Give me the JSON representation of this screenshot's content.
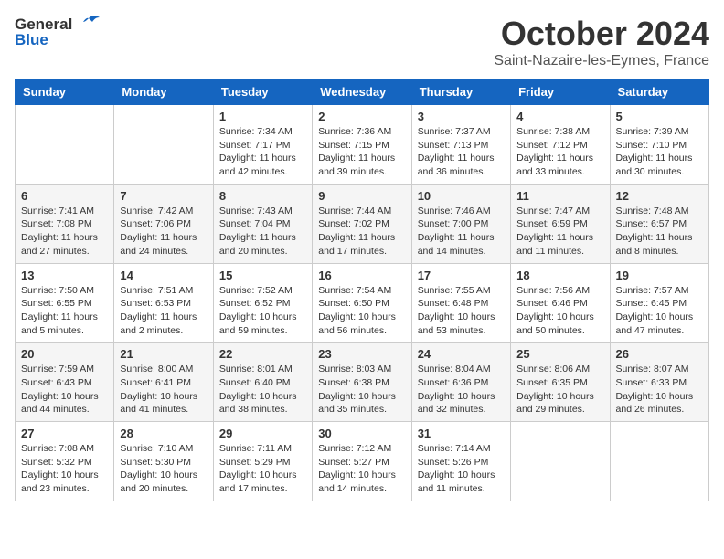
{
  "logo": {
    "general": "General",
    "blue": "Blue"
  },
  "title": {
    "month": "October 2024",
    "location": "Saint-Nazaire-les-Eymes, France"
  },
  "days_of_week": [
    "Sunday",
    "Monday",
    "Tuesday",
    "Wednesday",
    "Thursday",
    "Friday",
    "Saturday"
  ],
  "weeks": [
    [
      {
        "day": "",
        "info": ""
      },
      {
        "day": "",
        "info": ""
      },
      {
        "day": "1",
        "info": "Sunrise: 7:34 AM\nSunset: 7:17 PM\nDaylight: 11 hours and 42 minutes."
      },
      {
        "day": "2",
        "info": "Sunrise: 7:36 AM\nSunset: 7:15 PM\nDaylight: 11 hours and 39 minutes."
      },
      {
        "day": "3",
        "info": "Sunrise: 7:37 AM\nSunset: 7:13 PM\nDaylight: 11 hours and 36 minutes."
      },
      {
        "day": "4",
        "info": "Sunrise: 7:38 AM\nSunset: 7:12 PM\nDaylight: 11 hours and 33 minutes."
      },
      {
        "day": "5",
        "info": "Sunrise: 7:39 AM\nSunset: 7:10 PM\nDaylight: 11 hours and 30 minutes."
      }
    ],
    [
      {
        "day": "6",
        "info": "Sunrise: 7:41 AM\nSunset: 7:08 PM\nDaylight: 11 hours and 27 minutes."
      },
      {
        "day": "7",
        "info": "Sunrise: 7:42 AM\nSunset: 7:06 PM\nDaylight: 11 hours and 24 minutes."
      },
      {
        "day": "8",
        "info": "Sunrise: 7:43 AM\nSunset: 7:04 PM\nDaylight: 11 hours and 20 minutes."
      },
      {
        "day": "9",
        "info": "Sunrise: 7:44 AM\nSunset: 7:02 PM\nDaylight: 11 hours and 17 minutes."
      },
      {
        "day": "10",
        "info": "Sunrise: 7:46 AM\nSunset: 7:00 PM\nDaylight: 11 hours and 14 minutes."
      },
      {
        "day": "11",
        "info": "Sunrise: 7:47 AM\nSunset: 6:59 PM\nDaylight: 11 hours and 11 minutes."
      },
      {
        "day": "12",
        "info": "Sunrise: 7:48 AM\nSunset: 6:57 PM\nDaylight: 11 hours and 8 minutes."
      }
    ],
    [
      {
        "day": "13",
        "info": "Sunrise: 7:50 AM\nSunset: 6:55 PM\nDaylight: 11 hours and 5 minutes."
      },
      {
        "day": "14",
        "info": "Sunrise: 7:51 AM\nSunset: 6:53 PM\nDaylight: 11 hours and 2 minutes."
      },
      {
        "day": "15",
        "info": "Sunrise: 7:52 AM\nSunset: 6:52 PM\nDaylight: 10 hours and 59 minutes."
      },
      {
        "day": "16",
        "info": "Sunrise: 7:54 AM\nSunset: 6:50 PM\nDaylight: 10 hours and 56 minutes."
      },
      {
        "day": "17",
        "info": "Sunrise: 7:55 AM\nSunset: 6:48 PM\nDaylight: 10 hours and 53 minutes."
      },
      {
        "day": "18",
        "info": "Sunrise: 7:56 AM\nSunset: 6:46 PM\nDaylight: 10 hours and 50 minutes."
      },
      {
        "day": "19",
        "info": "Sunrise: 7:57 AM\nSunset: 6:45 PM\nDaylight: 10 hours and 47 minutes."
      }
    ],
    [
      {
        "day": "20",
        "info": "Sunrise: 7:59 AM\nSunset: 6:43 PM\nDaylight: 10 hours and 44 minutes."
      },
      {
        "day": "21",
        "info": "Sunrise: 8:00 AM\nSunset: 6:41 PM\nDaylight: 10 hours and 41 minutes."
      },
      {
        "day": "22",
        "info": "Sunrise: 8:01 AM\nSunset: 6:40 PM\nDaylight: 10 hours and 38 minutes."
      },
      {
        "day": "23",
        "info": "Sunrise: 8:03 AM\nSunset: 6:38 PM\nDaylight: 10 hours and 35 minutes."
      },
      {
        "day": "24",
        "info": "Sunrise: 8:04 AM\nSunset: 6:36 PM\nDaylight: 10 hours and 32 minutes."
      },
      {
        "day": "25",
        "info": "Sunrise: 8:06 AM\nSunset: 6:35 PM\nDaylight: 10 hours and 29 minutes."
      },
      {
        "day": "26",
        "info": "Sunrise: 8:07 AM\nSunset: 6:33 PM\nDaylight: 10 hours and 26 minutes."
      }
    ],
    [
      {
        "day": "27",
        "info": "Sunrise: 7:08 AM\nSunset: 5:32 PM\nDaylight: 10 hours and 23 minutes."
      },
      {
        "day": "28",
        "info": "Sunrise: 7:10 AM\nSunset: 5:30 PM\nDaylight: 10 hours and 20 minutes."
      },
      {
        "day": "29",
        "info": "Sunrise: 7:11 AM\nSunset: 5:29 PM\nDaylight: 10 hours and 17 minutes."
      },
      {
        "day": "30",
        "info": "Sunrise: 7:12 AM\nSunset: 5:27 PM\nDaylight: 10 hours and 14 minutes."
      },
      {
        "day": "31",
        "info": "Sunrise: 7:14 AM\nSunset: 5:26 PM\nDaylight: 10 hours and 11 minutes."
      },
      {
        "day": "",
        "info": ""
      },
      {
        "day": "",
        "info": ""
      }
    ]
  ]
}
